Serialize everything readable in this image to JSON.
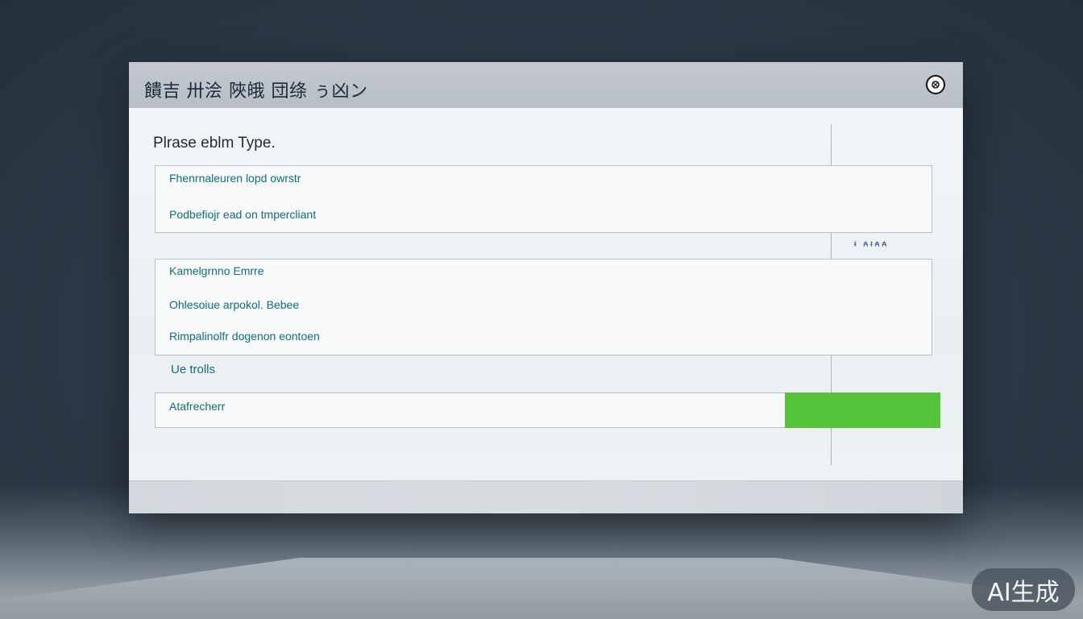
{
  "window": {
    "title": "饋吉 卅浍 陜皒 団绦 ぅ凶ン",
    "close_icon": "circle-glyph-icon"
  },
  "main": {
    "heading": "Plrase eblm Type.",
    "rows": [
      {
        "label": "Fhenrnaleuren lopd owrstr"
      },
      {
        "label": "Podbefiojr ead on tmpercliant"
      },
      {
        "label": "Kamelgrnno Emrre"
      },
      {
        "label": "Ohlesoiue arpokol. Bebee"
      },
      {
        "label": "Rimpalinolfr dogenon eontoen"
      }
    ],
    "small_text": "ᵮ   ₳ᵮ₳₳",
    "standalone_label": "Ue trolls",
    "action_row_label": "Atafrecherr",
    "action_button_color": "#55c43a"
  },
  "watermark": "AI生成"
}
